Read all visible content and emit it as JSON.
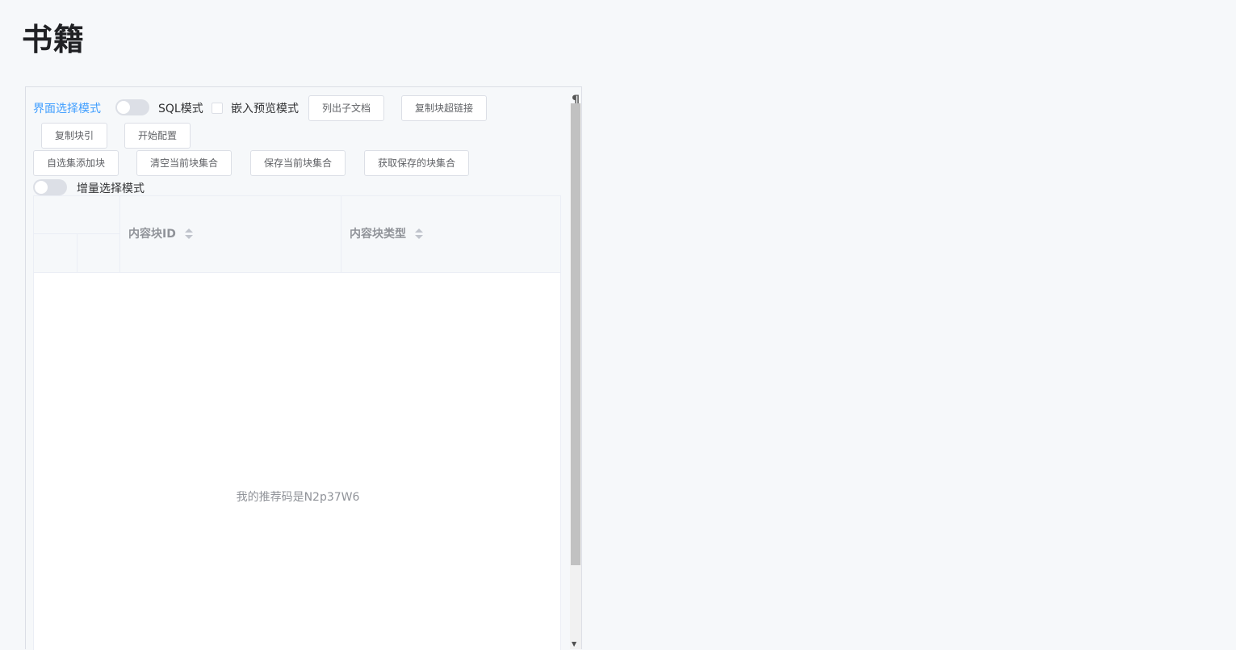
{
  "page": {
    "title": "书籍"
  },
  "toolbar": {
    "ui_select_mode_label": "界面选择模式",
    "sql_mode_label": "SQL模式",
    "embed_preview_label": "嵌入预览模式",
    "buttons": {
      "list_children": "列出子文档",
      "copy_block_link": "复制块超链接",
      "copy_block_ref": "复制块引",
      "start_config": "开始配置",
      "add_to_selection": "自选集添加块",
      "clear_current_set": "清空当前块集合",
      "save_current_set": "保存当前块集合",
      "load_saved_set": "获取保存的块集合"
    },
    "incremental_mode_label": "增量选择模式"
  },
  "table": {
    "columns": [
      "内容块ID",
      "内容块类型"
    ],
    "empty_text": "我的推荐码是N2p37W6"
  },
  "icons": {
    "pilcrow": "¶",
    "scroll_down": "▼"
  }
}
